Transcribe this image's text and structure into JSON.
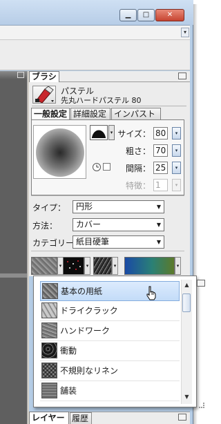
{
  "window": {
    "buttons": [
      {
        "name": "minimize",
        "glyph": "▁"
      },
      {
        "name": "maximize",
        "glyph": "□"
      },
      {
        "name": "close",
        "glyph": "✕"
      }
    ],
    "menu_glyph": "▾"
  },
  "brush_panel": {
    "tab_label": "ブラシ",
    "brush_name": "パステル",
    "brush_variant": "先丸ハードパステル 80",
    "tabs": [
      {
        "label": "一般設定",
        "active": true
      },
      {
        "label": "詳細設定",
        "active": false
      },
      {
        "label": "インパスト",
        "active": false
      }
    ],
    "params": [
      {
        "label": "サイズ：",
        "value": "80",
        "enabled": true
      },
      {
        "label": "粗さ：",
        "value": "70",
        "enabled": true
      },
      {
        "label": "間隔：",
        "value": "25",
        "enabled": true
      },
      {
        "label": "特徴：",
        "value": "1",
        "enabled": false
      }
    ],
    "spin_glyph": "▾",
    "rows": [
      {
        "label": "タイプ：",
        "value": "円形"
      },
      {
        "label": "方法：",
        "value": "カバー"
      },
      {
        "label": "カテゴリー",
        "value": "紙目硬筆"
      }
    ],
    "combo_arrow": "▼",
    "texture_drop_glyph": "▾"
  },
  "paper_popup": {
    "items": [
      {
        "label": "基本の用紙",
        "selected": true
      },
      {
        "label": "ドライクラック",
        "selected": false
      },
      {
        "label": "ハンドワーク",
        "selected": false
      },
      {
        "label": "衝動",
        "selected": false
      },
      {
        "label": "不規則なリネン",
        "selected": false
      },
      {
        "label": "舗装",
        "selected": false
      }
    ],
    "scroll_up": "▲",
    "scroll_down": "▼"
  },
  "bottom_panel": {
    "tabs": [
      {
        "label": "レイヤー",
        "active": true
      },
      {
        "label": "履歴",
        "active": false
      }
    ]
  },
  "icons": {
    "cursor": "pointer-hand-icon",
    "brush_tool": "pastel-brush-icon",
    "shape": "brush-shape-icon",
    "pressure": "pressure-icon"
  }
}
